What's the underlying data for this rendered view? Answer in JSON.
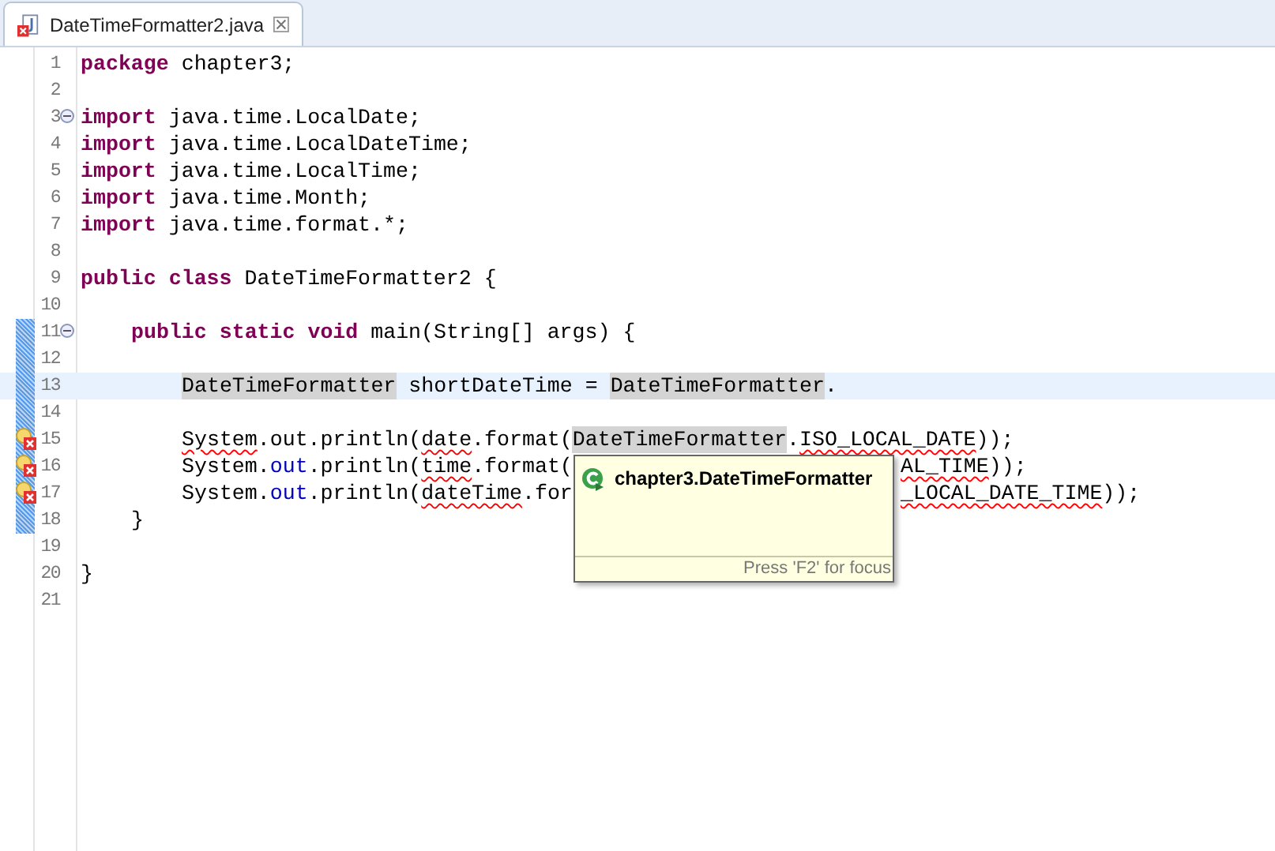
{
  "tab": {
    "title": "DateTimeFormatter2.java",
    "selected": true
  },
  "lines": [
    {
      "number": "1",
      "kind": "plain",
      "changed": false,
      "current": false,
      "tokens": [
        {
          "kind": "kw",
          "text": "package"
        },
        {
          "kind": "text",
          "text": " chapter3;"
        }
      ]
    },
    {
      "number": "2",
      "kind": "plain",
      "changed": false,
      "current": false
    },
    {
      "number": "3",
      "kind": "fold",
      "changed": false,
      "current": false,
      "tokens": [
        {
          "kind": "kw",
          "text": "import"
        },
        {
          "kind": "text",
          "text": " java.time.LocalDate;"
        }
      ]
    },
    {
      "number": "4",
      "kind": "plain",
      "changed": false,
      "current": false,
      "tokens": [
        {
          "kind": "kw",
          "text": "import"
        },
        {
          "kind": "text",
          "text": " java.time.LocalDateTime;"
        }
      ]
    },
    {
      "number": "5",
      "kind": "plain",
      "changed": false,
      "current": false,
      "tokens": [
        {
          "kind": "kw",
          "text": "import"
        },
        {
          "kind": "text",
          "text": " java.time.LocalTime;"
        }
      ]
    },
    {
      "number": "6",
      "kind": "plain",
      "changed": false,
      "current": false,
      "tokens": [
        {
          "kind": "kw",
          "text": "import"
        },
        {
          "kind": "text",
          "text": " java.time.Month;"
        }
      ]
    },
    {
      "number": "7",
      "kind": "plain",
      "changed": false,
      "current": false,
      "tokens": [
        {
          "kind": "kw",
          "text": "import"
        },
        {
          "kind": "text",
          "text": " java.time.format.*;"
        }
      ]
    },
    {
      "number": "8",
      "kind": "plain",
      "changed": false,
      "current": false
    },
    {
      "number": "9",
      "kind": "plain",
      "changed": false,
      "current": false,
      "tokens": [
        {
          "kind": "kw",
          "text": "public class"
        },
        {
          "kind": "text",
          "text": " DateTimeFormatter2 {"
        }
      ],
      "children": [
        {
          "number": "10",
          "kind": "plain",
          "changed": false,
          "current": false
        },
        {
          "number": "11",
          "kind": "fold",
          "changed": true,
          "current": false,
          "tokens": [
            {
              "kind": "kw",
              "text": "public static void"
            },
            {
              "kind": "text",
              "text": " main(String[] args) {"
            }
          ],
          "children": [
            {
              "number": "12",
              "kind": "plain",
              "changed": true,
              "current": false
            },
            {
              "number": "13",
              "kind": "plain",
              "changed": true,
              "current": true,
              "tokens": [
                {
                  "kind": "occurrence",
                  "text": "DateTimeFormatter"
                },
                {
                  "kind": "text",
                  "text": " shortDateTime = "
                },
                {
                  "kind": "occurrence",
                  "text": "DateTimeFormatter"
                },
                {
                  "kind": "text",
                  "text": "."
                }
              ]
            },
            {
              "number": "14",
              "kind": "plain",
              "changed": true,
              "current": false
            },
            {
              "number": "15",
              "kind": "error",
              "changed": true,
              "current": false,
              "tokens": [
                {
                  "kind": "error",
                  "text": "System"
                },
                {
                  "kind": "text",
                  "text": ".out.println("
                },
                {
                  "kind": "error",
                  "text": "date"
                },
                {
                  "kind": "text",
                  "text": ".format("
                },
                {
                  "kind": "occurrence",
                  "text": "DateTimeFormatter"
                },
                {
                  "kind": "text",
                  "text": "."
                },
                {
                  "kind": "error",
                  "text": "ISO_LOCAL_DATE"
                },
                {
                  "kind": "text",
                  "text": "));"
                }
              ]
            },
            {
              "number": "16",
              "kind": "error",
              "changed": true,
              "current": false,
              "tokens": [
                {
                  "kind": "text",
                  "text": "System."
                },
                {
                  "kind": "field",
                  "text": "out"
                },
                {
                  "kind": "text",
                  "text": ".println("
                },
                {
                  "kind": "error",
                  "text": "time"
                },
                {
                  "kind": "text",
                  "text": ".format("
                }
              ],
              "tail": [
                {
                  "kind": "error",
                  "text": "AL_TIME"
                },
                {
                  "kind": "text",
                  "text": "));"
                }
              ]
            },
            {
              "number": "17",
              "kind": "error",
              "changed": true,
              "current": false,
              "tokens": [
                {
                  "kind": "text",
                  "text": "System."
                },
                {
                  "kind": "field",
                  "text": "out"
                },
                {
                  "kind": "text",
                  "text": ".println("
                },
                {
                  "kind": "error",
                  "text": "dateTime"
                },
                {
                  "kind": "text",
                  "text": ".for"
                }
              ],
              "tail": [
                {
                  "kind": "error",
                  "text": "_LOCAL_DATE_TIME"
                },
                {
                  "kind": "text",
                  "text": "));"
                }
              ]
            }
          ]
        },
        {
          "number": "18",
          "kind": "plain",
          "changed": true,
          "current": false,
          "tokens": [
            {
              "kind": "text",
              "text": "}"
            }
          ]
        },
        {
          "number": "19",
          "kind": "plain",
          "changed": false,
          "current": false
        }
      ]
    },
    {
      "number": "20",
      "kind": "plain",
      "changed": false,
      "current": false,
      "tokens": [
        {
          "kind": "text",
          "text": "}"
        }
      ]
    },
    {
      "number": "21",
      "kind": "plain",
      "changed": false,
      "current": false
    }
  ],
  "hover": {
    "title": "chapter3.DateTimeFormatter",
    "footer": "Press 'F2' for focus"
  }
}
